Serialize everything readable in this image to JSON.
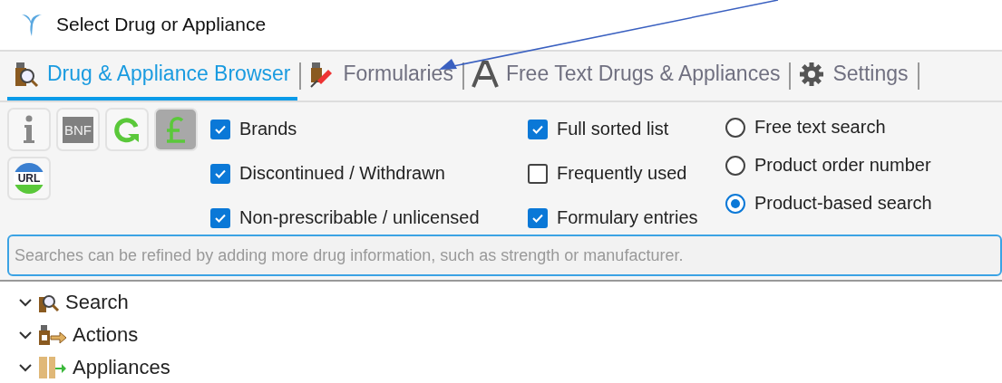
{
  "window": {
    "title": "Select Drug or Appliance"
  },
  "tabs": [
    {
      "label": "Drug & Appliance Browser",
      "selected": true
    },
    {
      "label": "Formularies",
      "selected": false
    },
    {
      "label": "Free Text Drugs & Appliances",
      "selected": false
    },
    {
      "label": "Settings",
      "selected": false
    }
  ],
  "tool_buttons": [
    {
      "kind": "info",
      "pressed": false
    },
    {
      "kind": "text",
      "label": "BNF",
      "pressed": false
    },
    {
      "kind": "refresh",
      "pressed": false
    },
    {
      "kind": "pound",
      "pressed": true
    },
    {
      "kind": "url",
      "label": "URL",
      "pressed": false
    }
  ],
  "filters_1": [
    {
      "label": "Brands",
      "checked": true
    },
    {
      "label": "Discontinued / Withdrawn",
      "checked": true
    },
    {
      "label": "Non-prescribable / unlicensed",
      "checked": true
    }
  ],
  "filters_2": [
    {
      "label": "Full sorted list",
      "checked": true
    },
    {
      "label": "Frequently used",
      "checked": false
    },
    {
      "label": "Formulary entries",
      "checked": true
    }
  ],
  "search_modes": [
    {
      "label": "Free text search",
      "selected": false
    },
    {
      "label": "Product order number",
      "selected": false
    },
    {
      "label": "Product-based search",
      "selected": true
    }
  ],
  "search": {
    "placeholder": "Searches can be refined by adding more drug information, such as strength or manufacturer."
  },
  "tree": [
    {
      "label": "Search",
      "expanded": true
    },
    {
      "label": "Actions",
      "expanded": true
    },
    {
      "label": "Appliances",
      "expanded": true
    }
  ]
}
